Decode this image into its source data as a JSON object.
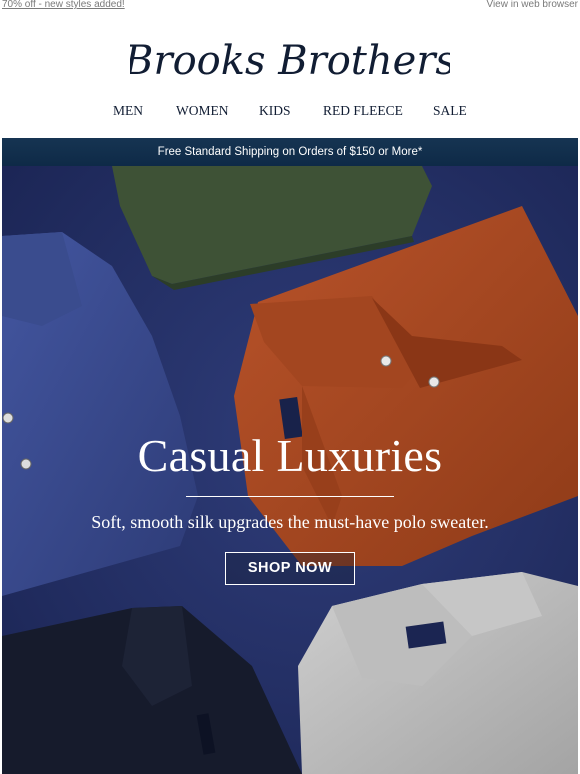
{
  "preheader": {
    "offer_link": "70% off - new styles added!",
    "web_view_link": "View in web browser"
  },
  "brand": {
    "logo_text": "Brooks Brothers"
  },
  "nav": {
    "items": [
      {
        "label": "MEN"
      },
      {
        "label": "WOMEN"
      },
      {
        "label": "KIDS"
      },
      {
        "label": "RED FLEECE"
      },
      {
        "label": "SALE"
      }
    ]
  },
  "banner": {
    "shipping_text": "Free Standard Shipping on Orders of $150 or More*"
  },
  "hero": {
    "headline": "Casual Luxuries",
    "subheadline": "Soft, smooth silk upgrades the must-have polo sweater.",
    "cta_label": "SHOP NOW",
    "image": "folded-polo-sweaters"
  },
  "colors": {
    "brand_navy": "#111d33",
    "banner_navy": "#0e2a47",
    "hero_background": "#26336b",
    "sweater_rust": "#a8481f",
    "sweater_green": "#3e5236",
    "sweater_blue": "#3a4c8a",
    "sweater_grey": "#b9b9b9",
    "sweater_navy": "#161b2c"
  }
}
